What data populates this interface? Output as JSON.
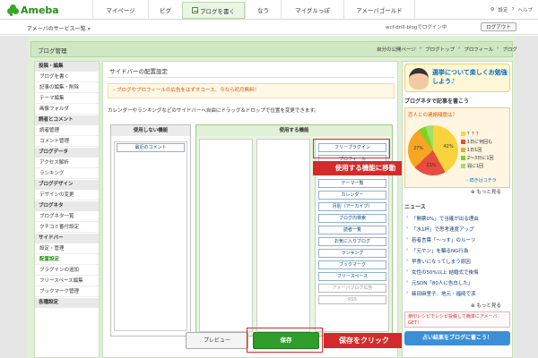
{
  "topbar": {
    "logo": "Ameba",
    "nav": [
      "マイページ",
      "ピグ",
      "ブログを書く",
      "なう",
      "マイグルっぽ",
      "アメーバゴールド"
    ],
    "right_links": [
      "設定",
      "ヘルプ"
    ]
  },
  "subbar": {
    "service_list": "アメーバのサービス一覧",
    "user_status": "wcf-drill-blogでログイン中",
    "logout": "ログアウト"
  },
  "header": {
    "title": "ブログ管理",
    "links": [
      "自分の公開ページ",
      "ブログトップ",
      "プロフィール",
      "ブログ"
    ]
  },
  "sidebar": {
    "sections": [
      {
        "title": "投稿・編集",
        "items": [
          "ブログを書く",
          "記事の編集・削除",
          "テーマ編集",
          "画像フォルダ"
        ]
      },
      {
        "title": "読者とコメント",
        "items": [
          "読者管理",
          "コメント管理"
        ]
      },
      {
        "title": "ブログデータ",
        "items": [
          "アクセス解析",
          "ランキング"
        ]
      },
      {
        "title": "ブログデザイン",
        "items": [
          "デザインの変更"
        ]
      },
      {
        "title": "ブログネタ",
        "items": [
          "ブログネタ一覧",
          "クチコミ番付設定"
        ]
      },
      {
        "title": "サイドバー",
        "items": [
          "設定・管理",
          "配置設定",
          "プラグインの追加",
          "フリースペース編集",
          "ブックマーク管理"
        ]
      },
      {
        "title": "各種設定",
        "items": []
      }
    ],
    "active_item": "配置設定"
  },
  "main": {
    "title": "サイドバーの配置設定",
    "notice": "ブログやプロフィールの広告をはずすコース、今なら初月無料！",
    "description": "カレンダーやランキングなどのサイドバーへ自由にドラッグ＆ドロップで位置を変更できます。",
    "unused_box": {
      "title": "使用しない機能",
      "items": [
        "最近のコメント"
      ]
    },
    "used_box": {
      "title": "使用する機能",
      "items": [
        "フリープラグイン",
        "プロフィール",
        "テーマ一覧",
        "カレンダー",
        "月別（アーカイブ）",
        "ブログ内検索",
        "読者一覧",
        "お気に入りブログ",
        "ランキング",
        "ブックマーク",
        "フリースペース",
        "アメーバブログ広告",
        "RSS"
      ],
      "disabled_items": [
        "アメーバブログ広告",
        "RSS"
      ]
    },
    "callout_move": "使用する機能に移動",
    "preview_button": "プレビュー",
    "save_button": "保存",
    "callout_save": "保存をクリック"
  },
  "right": {
    "banner": "選挙について楽しくお勉強しよう♪",
    "neta_title": "ブログネタで記事を書こう",
    "survey": {
      "question": "恋人との連絡頻度は？",
      "legend": [
        "？？？",
        "1日に何回も",
        "1日1回",
        "2～3日に1回",
        "週に1回"
      ],
      "footer_link": "続きはコチラ"
    },
    "more": "もっと見る",
    "news_title": "ニュース",
    "news": [
      "「開票0%」で当確が出る理由",
      "「水1杯」で思考速度アップ",
      "若者言葉「〜っす」のルーツ",
      "「元ヤン」を騙るNG行為",
      "早食いになってしまう原因",
      "女性の50%以上 結婚式で後悔",
      "元SDN「80人に告白した」",
      "篠田麻里子、地元・福岡で涙"
    ],
    "ad_text": "楽印レシピでレシピ投稿して簡単にアメーバGET！",
    "ad_button": "占い結果をブログに書こう！"
  },
  "chart_data": {
    "type": "pie",
    "title": "恋人との連絡頻度は？",
    "categories": [
      "？？？",
      "1日に何回も",
      "1日1回",
      "2～3日に1回",
      "週に1回"
    ],
    "values": [
      42,
      21,
      27,
      5,
      5
    ],
    "colors": [
      "#f9d33c",
      "#e74c3c",
      "#f5a623",
      "#7ed321",
      "#a0e06b"
    ]
  }
}
